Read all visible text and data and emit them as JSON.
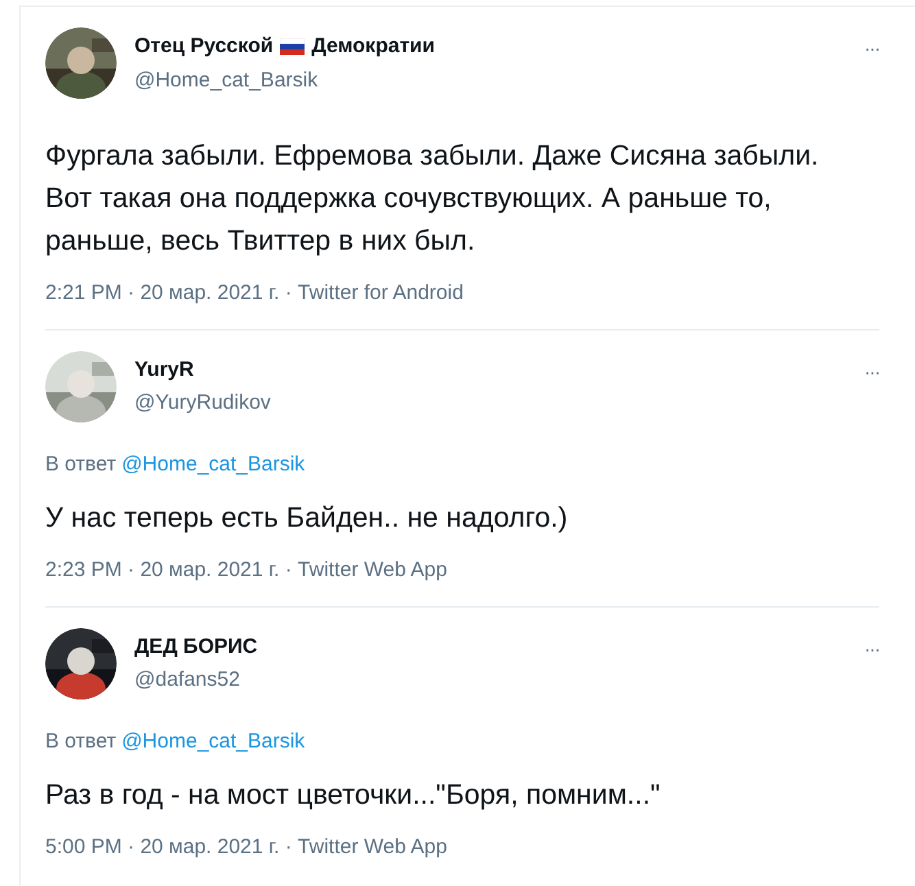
{
  "tweets": [
    {
      "name_parts": [
        {
          "kind": "text",
          "text": "Отец Русской"
        },
        {
          "kind": "flag"
        },
        {
          "kind": "text",
          "text": "Демократии"
        }
      ],
      "handle": "@Home_cat_Barsik",
      "more": "···",
      "text": "Фургала забыли. Ефремова забыли. Даже Сисяна забыли. Вот такая она поддержка сочувствующих. А раньше то, раньше, весь Твиттер в них был.",
      "meta": "2:21 PM · 20 мар. 2021 г. · Twitter for Android"
    },
    {
      "name_parts": [
        {
          "kind": "text",
          "text": "YuryR"
        }
      ],
      "handle": "@YuryRudikov",
      "more": "···",
      "reply_label": "В ответ",
      "reply_to": "@Home_cat_Barsik",
      "text": "У нас теперь есть Байден.. не надолго.)",
      "meta": "2:23 PM · 20 мар. 2021 г. · Twitter Web App"
    },
    {
      "name_parts": [
        {
          "kind": "text",
          "text": "ДЕД БОРИС"
        }
      ],
      "handle": "@dafans52",
      "more": "···",
      "reply_label": "В ответ",
      "reply_to": "@Home_cat_Barsik",
      "text": "Раз в год - на мост цветочки...\"Боря, помним...\"",
      "meta": "5:00 PM · 20 мар. 2021 г. · Twitter Web App"
    }
  ]
}
